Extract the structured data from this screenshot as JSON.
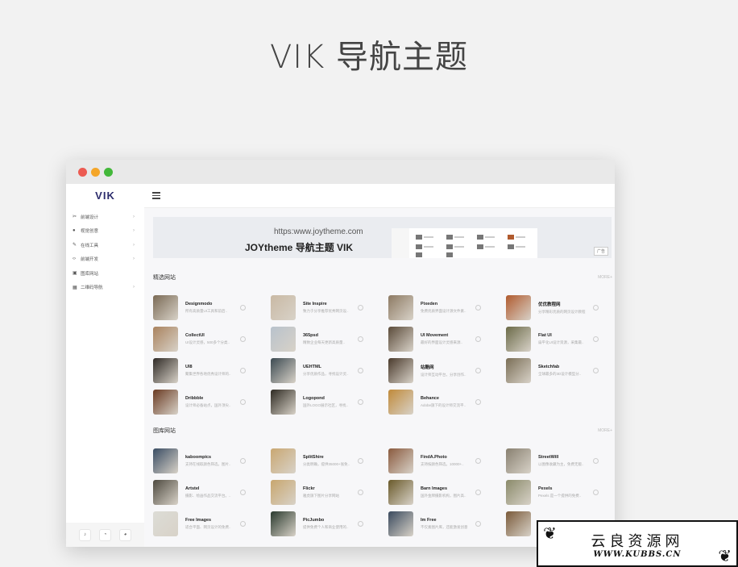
{
  "hero": {
    "title": "VIK 导航主题"
  },
  "sidebar": {
    "logo": "VIK",
    "items": [
      {
        "label": "前端设计",
        "icon": "scissors-icon"
      },
      {
        "label": "视觉创意",
        "icon": "drop-icon"
      },
      {
        "label": "在线工具",
        "icon": "pen-icon"
      },
      {
        "label": "前端开发",
        "icon": "code-icon"
      },
      {
        "label": "图库网站",
        "icon": "image-icon"
      },
      {
        "label": "二维码导航",
        "icon": "qrcode-icon"
      }
    ],
    "bottom": [
      "bell-icon",
      "weibo-icon",
      "wechat-icon"
    ]
  },
  "banner": {
    "url": "https:www.joytheme.com",
    "title": "JOYtheme 导航主题 VIK",
    "ad_label": "广告"
  },
  "sections": [
    {
      "title": "精选网站",
      "more": "MORE+",
      "items": [
        {
          "name": "Designmodo",
          "desc": "所有高质量UI工具和前后..",
          "color": "#7a6a55"
        },
        {
          "name": "Site Inspire",
          "desc": "致力于分享推荐优秀网页设..",
          "color": "#c9b9a4"
        },
        {
          "name": "Pixeden",
          "desc": "免费优质界面设计源文件素..",
          "color": "#8d7a63"
        },
        {
          "name": "优优教程网",
          "desc": "分享精彩优质的网页设计教程",
          "color": "#b05a2e"
        },
        {
          "name": "CollectUI",
          "desc": "UI设计灵感，500多个分类..",
          "color": "#a9825e"
        },
        {
          "name": "365psd",
          "desc": "精致企业每天更新高质量..",
          "color": "#b8c2cc"
        },
        {
          "name": "UI Movement",
          "desc": "最好的界面设计灵感来源..",
          "color": "#5b4b3a"
        },
        {
          "name": "Flat UI",
          "desc": "扁平化UI设计资源，采集最..",
          "color": "#6b6a48"
        },
        {
          "name": "UI8",
          "desc": "聚集世界各地优秀设计师的..",
          "color": "#2f2a26"
        },
        {
          "name": "UEHTML",
          "desc": "分享优质作品，寻找设计灵..",
          "color": "#3c4a52"
        },
        {
          "name": "站酷网",
          "desc": "设计师互动平台，分享创作..",
          "color": "#4a3a2c"
        },
        {
          "name": "Sketchfab",
          "desc": "全球最多的3D设计模型分..",
          "color": "#7a6e56"
        },
        {
          "name": "Dribbble",
          "desc": "设计师必备站点，国外顶尖..",
          "color": "#6a3a22"
        },
        {
          "name": "Logopond",
          "desc": "国外LOGO展示社区，寻找..",
          "color": "#2e2a22"
        },
        {
          "name": "Behance",
          "desc": "Adobe旗下的设计师交流平..",
          "color": "#c08a3a"
        }
      ]
    },
    {
      "title": "图库网站",
      "more": "MORE+",
      "items": [
        {
          "name": "kaboompics",
          "desc": "支持在线取颜色筛选，图片..",
          "color": "#394c63"
        },
        {
          "name": "SplitShire",
          "desc": "分类明确，提供35000+张免..",
          "color": "#c9a772"
        },
        {
          "name": "FindA.Photo",
          "desc": "支持按颜色筛选，10000+..",
          "color": "#8a5a3e"
        },
        {
          "name": "StreetWill",
          "desc": "以图像收藏为主，免费无版..",
          "color": "#888070"
        },
        {
          "name": "Artstel",
          "desc": "摄影、绘画作品交流平台。..",
          "color": "#4e4a40"
        },
        {
          "name": "Flickr",
          "desc": "雅虎旗下图片分享网站",
          "color": "#c8a66e"
        },
        {
          "name": "Barn Images",
          "desc": "国外金牌摄影机构，图片高..",
          "color": "#6a5a2a"
        },
        {
          "name": "Pexels",
          "desc": "Pexels 是一个提供的免费..",
          "color": "#8a8a6a"
        },
        {
          "name": "Free Images",
          "desc": "适合平面、网页设计的免费..",
          "color": "#dcdcd6"
        },
        {
          "name": "PicJumbo",
          "desc": "提供免费个人和商业使用的..",
          "color": "#2a3a2e"
        },
        {
          "name": "Im Free",
          "desc": "不仅素图片库，还能激发创意",
          "color": "#3a4a5e"
        },
        {
          "name": "",
          "desc": "",
          "color": "#7a5a3a"
        }
      ]
    }
  ],
  "watermark": {
    "title": "云良资源网",
    "url": "WWW.KUBBS.CN"
  }
}
